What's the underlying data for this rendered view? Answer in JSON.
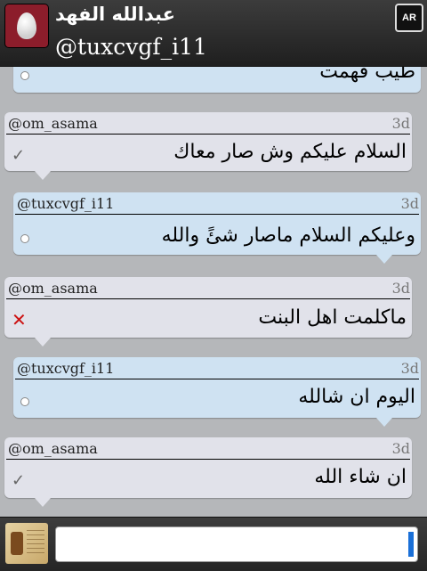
{
  "header": {
    "name": "عبدالله الفهد",
    "handle": "@tuxcvgf_i11",
    "lang_button": "AR"
  },
  "messages": [
    {
      "id": "m0",
      "direction": "out",
      "text": "طيب فهمت",
      "status": "sent-circle"
    },
    {
      "id": "m1",
      "direction": "in",
      "sender": "@om_asama",
      "time": "3d",
      "text": "السلام عليكم وش صار معاك",
      "status": "read-check"
    },
    {
      "id": "m2",
      "direction": "out",
      "sender": "@tuxcvgf_i11",
      "time": "3d",
      "text": "وعليكم السلام ماصار شئً والله",
      "status": "sent-circle"
    },
    {
      "id": "m3",
      "direction": "in",
      "sender": "@om_asama",
      "time": "3d",
      "text": "ماكلمت اهل البنت",
      "status": "failed-x"
    },
    {
      "id": "m4",
      "direction": "out",
      "sender": "@tuxcvgf_i11",
      "time": "3d",
      "text": "اليوم ان شالله",
      "status": "sent-circle"
    },
    {
      "id": "m5",
      "direction": "in",
      "sender": "@om_asama",
      "time": "3d",
      "text": "ان شاء الله",
      "status": "read-check"
    }
  ],
  "composer": {
    "value": "",
    "attachment": "image-attachment-thumbnail"
  }
}
